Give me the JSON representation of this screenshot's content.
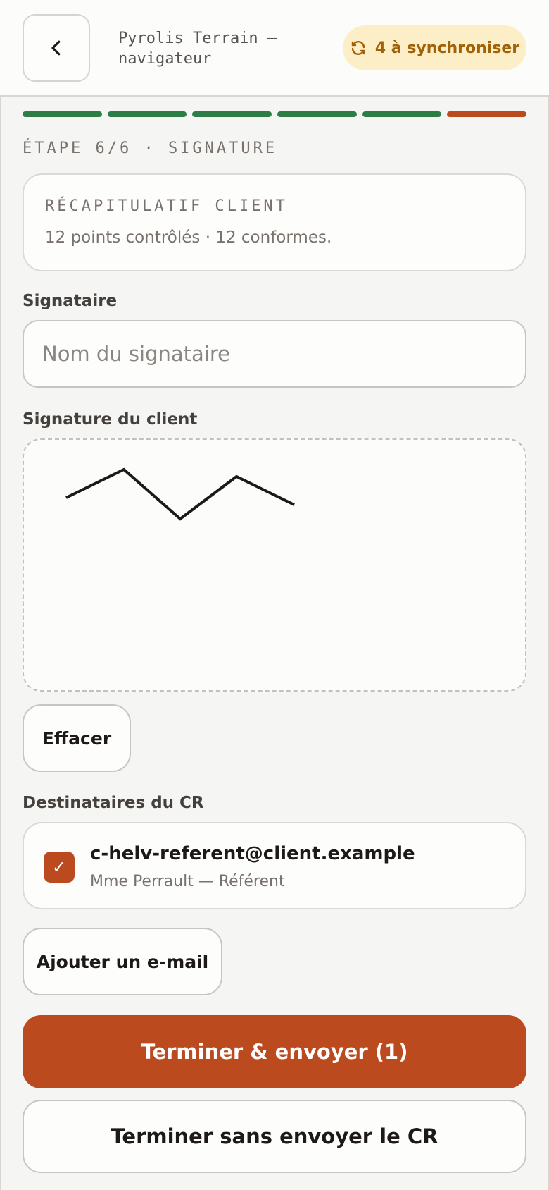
{
  "header": {
    "back_icon": "chevron-left-icon",
    "app_title": "Pyrolis Terrain — navigateur",
    "sync_icon": "sync-icon",
    "sync_label": "4 à synchroniser"
  },
  "progress": {
    "total_steps": 6,
    "current_step": 6,
    "done_color": "#2f7d46",
    "current_color": "#bb4a1f"
  },
  "step_label": "ÉTAPE 6/6 · SIGNATURE",
  "summary": {
    "title": "RÉCAPITULATIF CLIENT",
    "text": "12 points contrôlés · 12 conformes."
  },
  "signatory": {
    "label": "Signataire",
    "value": "",
    "placeholder": "Nom du signataire"
  },
  "signature": {
    "label": "Signature du client",
    "clear_label": "Effacer"
  },
  "recipients": {
    "label": "Destinataires du CR",
    "items": [
      {
        "checked": true,
        "email": "c-helv-referent@client.example",
        "name": "Mme Perrault — Référent"
      }
    ],
    "add_label": "Ajouter un e-mail"
  },
  "actions": {
    "finish_send_label": "Terminer & envoyer (1)",
    "finish_no_send_label": "Terminer sans envoyer le CR"
  },
  "colors": {
    "accent": "#bb4a1f",
    "success": "#2f7d46",
    "sync_badge_bg": "#fcefc7",
    "sync_badge_text": "#a16207"
  }
}
